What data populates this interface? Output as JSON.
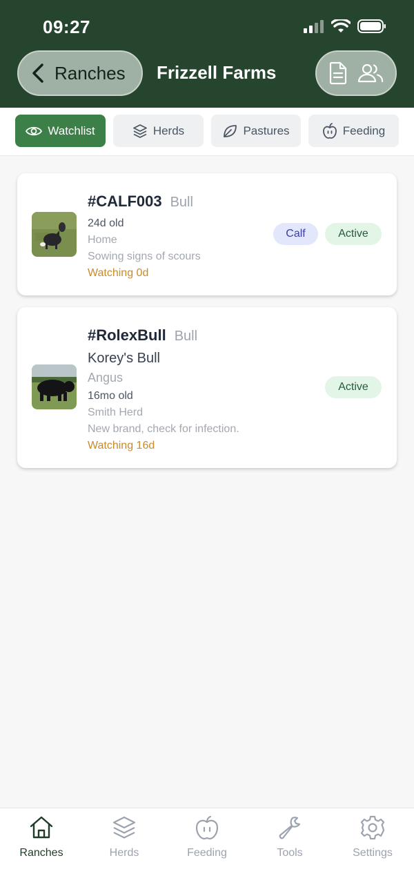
{
  "status": {
    "time": "09:27"
  },
  "header": {
    "back_label": "Ranches",
    "title": "Frizzell Farms"
  },
  "tabs": [
    {
      "label": "Watchlist",
      "icon": "eye-icon",
      "active": true
    },
    {
      "label": "Herds",
      "icon": "layers-icon",
      "active": false
    },
    {
      "label": "Pastures",
      "icon": "leaf-icon",
      "active": false
    },
    {
      "label": "Feeding",
      "icon": "apple-icon",
      "active": false
    }
  ],
  "animals": [
    {
      "tag": "#CALF003",
      "sex": "Bull",
      "age": "24d old",
      "location": "Home",
      "note": "Sowing signs of scours",
      "watching": "Watching 0d",
      "badges": [
        "Calf",
        "Active"
      ]
    },
    {
      "tag": "#RolexBull",
      "sex": "Bull",
      "name": "Korey's Bull",
      "breed": "Angus",
      "age": "16mo old",
      "location": "Smith Herd",
      "note": "New brand, check for infection.",
      "watching": "Watching 16d",
      "badges": [
        "Active"
      ]
    }
  ],
  "bottom_nav": [
    {
      "label": "Ranches",
      "icon": "home-icon",
      "active": true
    },
    {
      "label": "Herds",
      "icon": "layers-icon",
      "active": false
    },
    {
      "label": "Feeding",
      "icon": "apple-icon",
      "active": false
    },
    {
      "label": "Tools",
      "icon": "wrench-icon",
      "active": false
    },
    {
      "label": "Settings",
      "icon": "gear-icon",
      "active": false
    }
  ],
  "colors": {
    "header": "#25452e",
    "accent": "#3c8048",
    "watching": "#c98a2c"
  }
}
